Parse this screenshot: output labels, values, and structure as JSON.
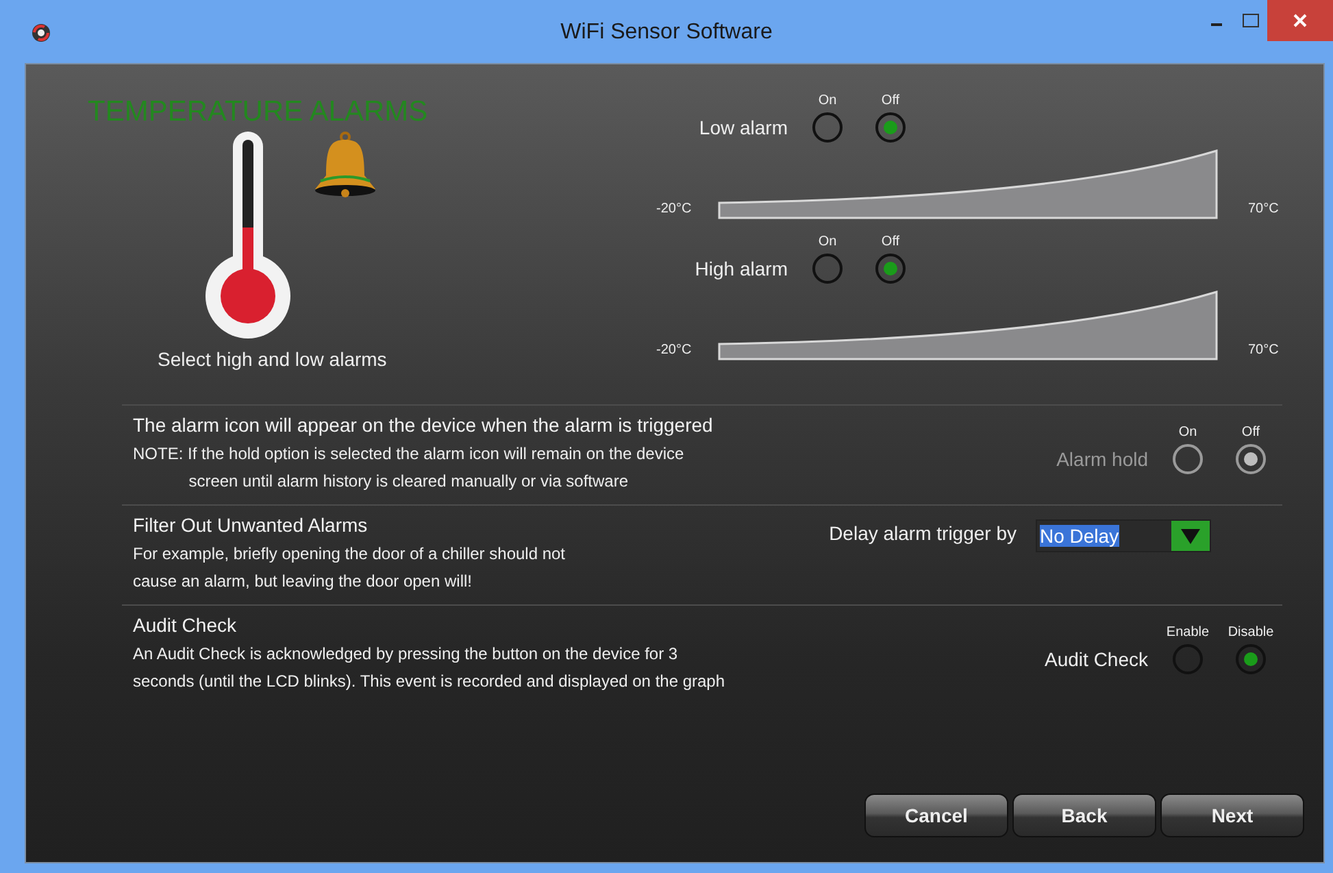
{
  "window": {
    "title": "WiFi Sensor Software"
  },
  "heading": "TEMPERATURE ALARMS",
  "caption": "Select high and low alarms",
  "alarms": [
    {
      "label": "Low alarm",
      "options": [
        {
          "label": "On",
          "selected": false
        },
        {
          "label": "Off",
          "selected": true
        }
      ],
      "min_label": "-20°C",
      "max_label": "70°C"
    },
    {
      "label": "High alarm",
      "options": [
        {
          "label": "On",
          "selected": false
        },
        {
          "label": "Off",
          "selected": true
        }
      ],
      "min_label": "-20°C",
      "max_label": "70°C"
    }
  ],
  "sections": [
    {
      "kind": "radio",
      "title": "The alarm icon will appear on the device when the alarm is triggered",
      "centered": true,
      "lines": [
        "NOTE: If the hold option is selected the alarm icon will remain on the device",
        "screen until alarm history is cleared manually or via software"
      ],
      "control": {
        "label": "Alarm hold",
        "disabled": true,
        "options": [
          {
            "label": "On",
            "selected": false
          },
          {
            "label": "Off",
            "selected": true
          }
        ]
      }
    },
    {
      "kind": "dropdown",
      "title": "Filter Out Unwanted Alarms",
      "centered": false,
      "lines": [
        "For example, briefly opening the door of a chiller should not",
        "cause an alarm, but leaving the door open will!"
      ],
      "control": {
        "label": "Delay alarm trigger by",
        "value": "No Delay"
      }
    },
    {
      "kind": "radio",
      "title": "Audit Check",
      "centered": false,
      "lines": [
        "An Audit Check is acknowledged by pressing the button on the device for 3",
        "seconds (until the LCD blinks). This event is recorded and displayed on the graph"
      ],
      "control": {
        "label": "Audit Check",
        "disabled": false,
        "options": [
          {
            "label": "Enable",
            "selected": false
          },
          {
            "label": "Disable",
            "selected": true
          }
        ]
      }
    }
  ],
  "buttons": [
    "Cancel",
    "Back",
    "Next"
  ]
}
